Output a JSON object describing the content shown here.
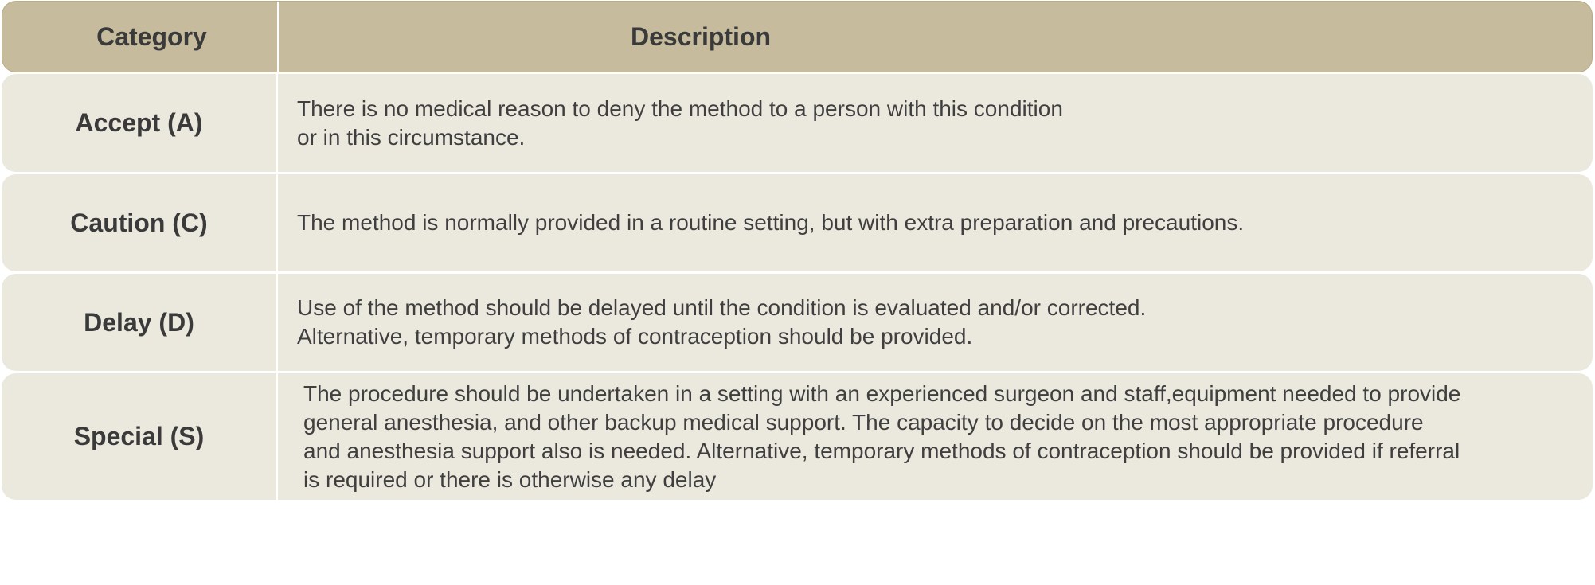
{
  "table": {
    "headers": {
      "category": "Category",
      "description": "Description"
    },
    "rows": [
      {
        "category": "Accept (A)",
        "description": "There is no medical reason to deny the method to a person with this condition\nor in this circumstance."
      },
      {
        "category": "Caution (C)",
        "description": "The method is normally provided in a routine setting, but with extra preparation and precautions."
      },
      {
        "category": "Delay (D)",
        "description": "Use of the method should be delayed until the condition is evaluated and/or corrected.\nAlternative, temporary methods of contraception should be provided."
      },
      {
        "category": "Special (S)",
        "description": "The procedure should be undertaken in a setting with an experienced surgeon and staff,equipment needed to provide\ngeneral anesthesia, and other backup medical support. The capacity to decide on the most appropriate procedure\nand anesthesia support also is needed. Alternative, temporary methods of contraception should be provided if referral\nis required or there is otherwise any delay"
      }
    ]
  },
  "colors": {
    "header_bg": "#c6bb9c",
    "row_bg": "#ebe8dd",
    "text": "#3f3f3f"
  }
}
